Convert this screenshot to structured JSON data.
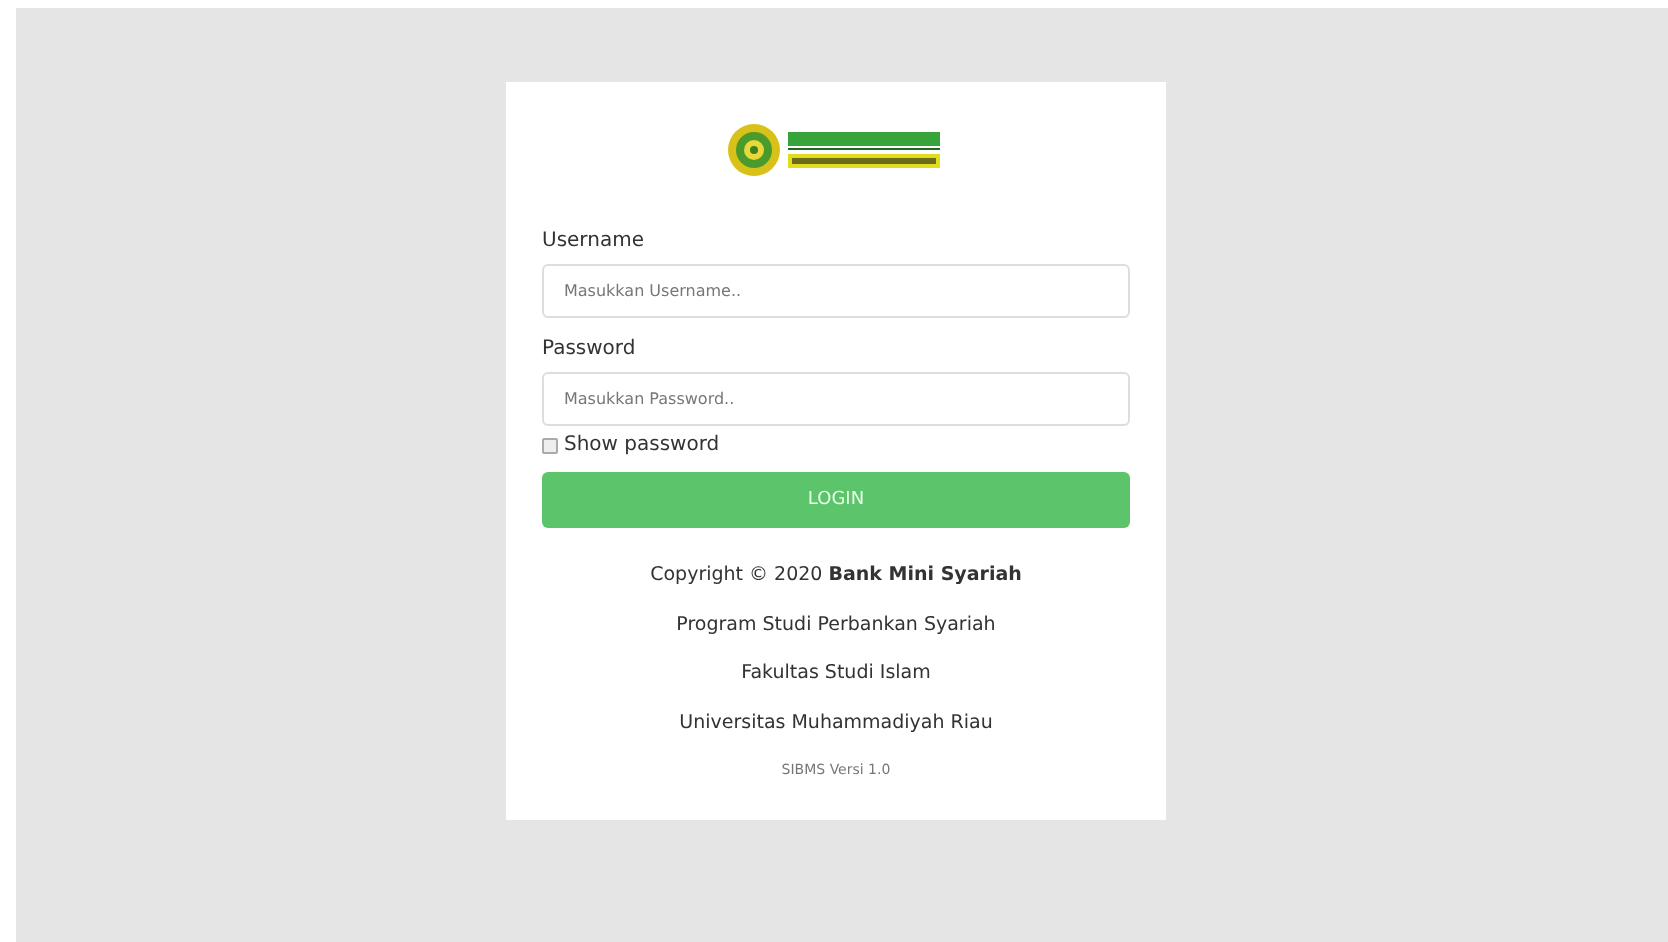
{
  "fields": [
    {
      "label": "Username",
      "placeholder": "Masukkan Username.."
    },
    {
      "label": "Password",
      "placeholder": "Masukkan Password.."
    }
  ],
  "show_password": {
    "label": "Show password",
    "checked": false
  },
  "login_button": "LOGIN",
  "footer": {
    "copyright": "Copyright © 2020 **Bank Mini Syariah**",
    "lines": [
      "Program Studi Perbankan Syariah",
      "Fakultas Studi Islam",
      "Universitas Muhammadiyah Riau"
    ],
    "version": "SIBMS Versi 1.0"
  }
}
